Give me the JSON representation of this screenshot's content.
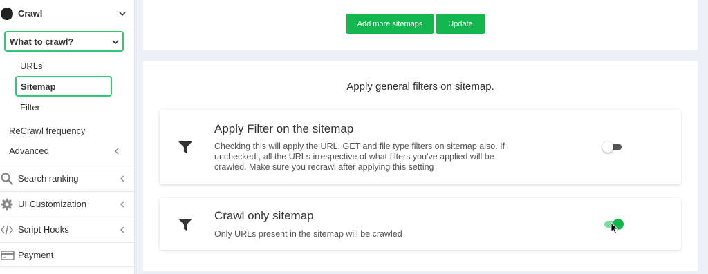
{
  "sidebar": {
    "crawl_label": "Crawl",
    "what_to_crawl_label": "What to crawl?",
    "sub_items": [
      "URLs",
      "Sitemap",
      "Filter"
    ],
    "recrawl_label": "ReCrawl frequency",
    "advanced_label": "Advanced",
    "nav": [
      {
        "label": "Search ranking",
        "icon": "search-icon"
      },
      {
        "label": "UI Customization",
        "icon": "gear-icon"
      },
      {
        "label": "Script Hooks",
        "icon": "code-icon"
      },
      {
        "label": "Payment",
        "icon": "credit-card-icon"
      }
    ]
  },
  "toolbar": {
    "add_sitemaps_label": "Add more sitemaps",
    "update_label": "Update"
  },
  "main": {
    "heading": "Apply general filters on sitemap.",
    "settings": [
      {
        "title": "Apply Filter on the sitemap",
        "description": "Checking this will apply the URL, GET and file type filters on sitemap also. If unchecked , all the URLs irrespective of what filters you've applied will be crawled. Make sure you recrawl after applying this setting",
        "icon": "filter-icon",
        "enabled": false
      },
      {
        "title": "Crawl only sitemap",
        "description": "Only URLs present in the sitemap will be crawled",
        "icon": "filter-icon",
        "enabled": true
      }
    ]
  },
  "colors": {
    "accent": "#12b84e",
    "highlight_border": "#2ecc71"
  }
}
